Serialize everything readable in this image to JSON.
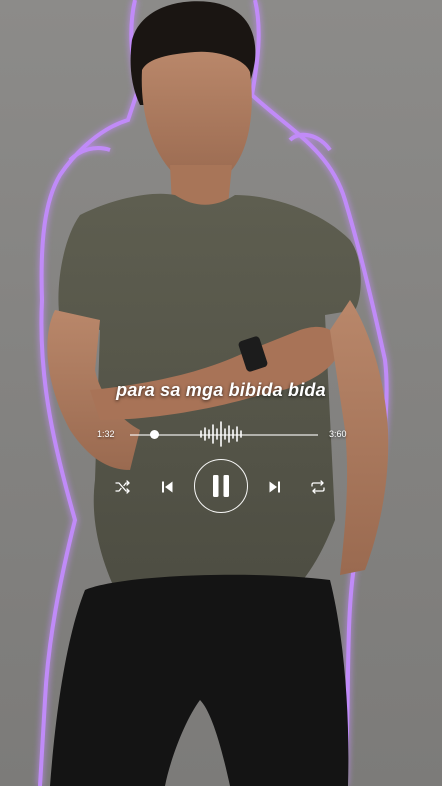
{
  "player": {
    "lyric": "para sa mga bibida bida",
    "current_time": "1:32",
    "total_time": "3:60",
    "progress": 0.13
  },
  "icons": {
    "shuffle": "shuffle-icon",
    "previous": "previous-icon",
    "pause": "pause-icon",
    "next": "next-icon",
    "repeat": "repeat-icon",
    "waveform": "waveform-icon"
  },
  "colors": {
    "glow": "#b97cff",
    "foreground": "#ffffff"
  }
}
